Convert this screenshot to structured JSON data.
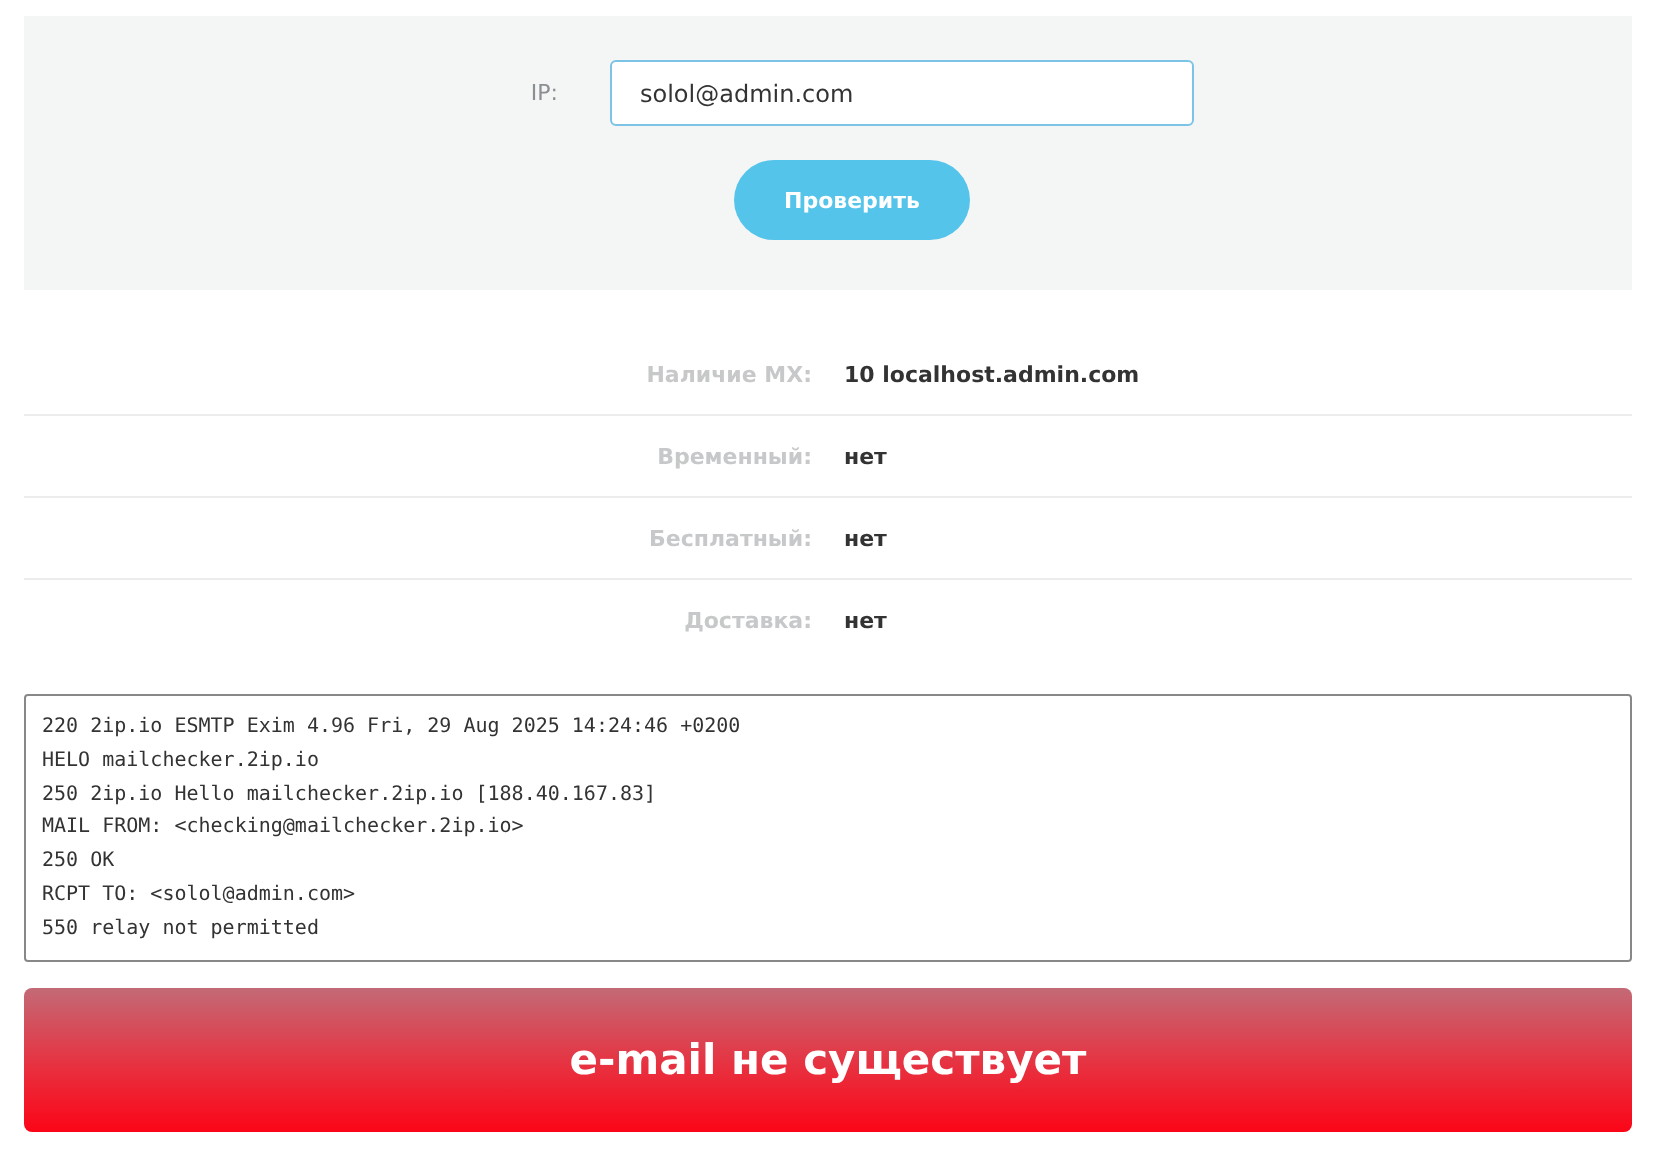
{
  "form": {
    "label": "IP:",
    "value": "solol@admin.com",
    "button": "Проверить"
  },
  "results": [
    {
      "label": "Наличие MX:",
      "value": "10 localhost.admin.com"
    },
    {
      "label": "Временный:",
      "value": "нет"
    },
    {
      "label": "Бесплатный:",
      "value": "нет"
    },
    {
      "label": "Доставка:",
      "value": "нет"
    }
  ],
  "log": [
    "220 2ip.io ESMTP Exim 4.96 Fri, 29 Aug 2025 14:24:46 +0200",
    "HELO mailchecker.2ip.io",
    "250 2ip.io Hello mailchecker.2ip.io [188.40.167.83]",
    "MAIL FROM: <checking@mailchecker.2ip.io>",
    "250 OK",
    "RCPT TO: <solol@admin.com>",
    "550 relay not permitted"
  ],
  "verdict": "e-mail не существует"
}
